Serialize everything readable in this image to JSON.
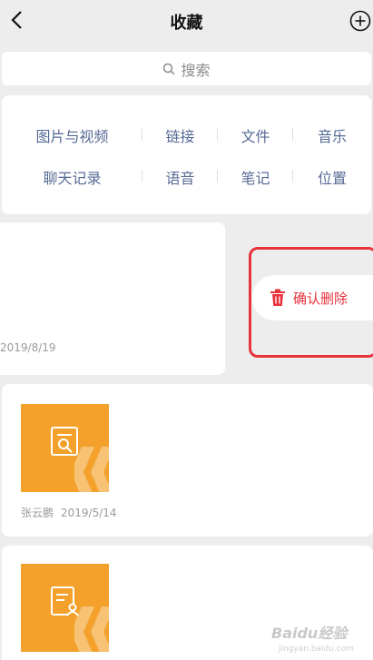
{
  "nav": {
    "title": "收藏",
    "back_icon": "chevron-left-icon",
    "add_icon": "plus-circle-icon"
  },
  "search": {
    "placeholder": "搜索",
    "icon": "search-icon"
  },
  "categories": [
    [
      "图片与视频",
      "链接",
      "文件",
      "音乐"
    ],
    [
      "聊天记录",
      "语音",
      "笔记",
      "位置"
    ]
  ],
  "items": [
    {
      "date": "2019/8/19"
    },
    {
      "author": "张云鹏",
      "date": "2019/5/14",
      "icon": "document-search-icon"
    },
    {
      "icon": "document-user-icon"
    }
  ],
  "swipe_action": {
    "label": "确认删除",
    "icon": "trash-icon"
  },
  "colors": {
    "accent_link": "#576b95",
    "danger": "#e8323c",
    "thumb": "#f3a12a",
    "background": "#ededed"
  },
  "watermark": {
    "text": "Baidu经验",
    "sub": "jingyan.baidu.com"
  }
}
